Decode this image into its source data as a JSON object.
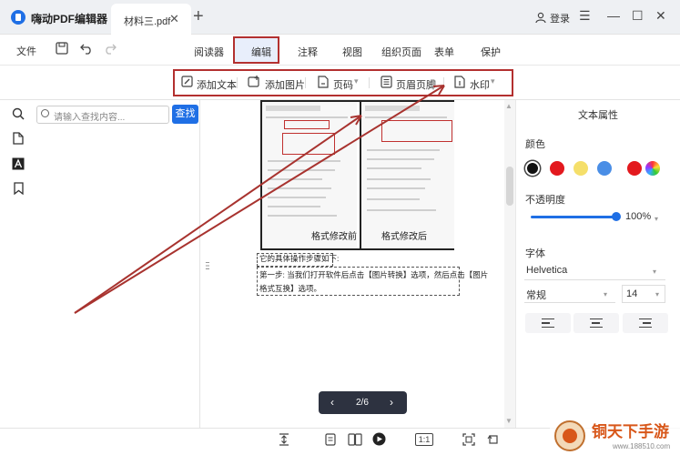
{
  "window": {
    "app_name": "嗨动PDF编辑器",
    "doc_tab": "材料三.pdf",
    "doc_tab_close": "✕",
    "add_tab": "+",
    "login": "登录",
    "controls": [
      "☰",
      "—",
      "☐",
      "✕"
    ]
  },
  "toolbar": {
    "file_menu": "文件",
    "tabs": [
      "阅读器",
      "编辑",
      "注释",
      "视图",
      "组织页面",
      "表单",
      "保护"
    ],
    "active_tab": "编辑"
  },
  "edit_tools": {
    "add_text": "添加文本",
    "add_image": "添加图片",
    "page_number": "页码",
    "header_footer": "页眉页脚",
    "watermark": "水印"
  },
  "sidebar": {
    "search_placeholder": "请输入查找内容...",
    "search_button": "查找",
    "icons": [
      "search-icon",
      "page-icon",
      "text-icon",
      "bookmark-icon"
    ]
  },
  "document": {
    "caption_before": "格式修改前",
    "caption_after": "格式修改后",
    "step_intro": "它的具体操作步骤如下:",
    "step_line1": "第一步: 当我们打开软件后点击【图片转换】选项，然后点击【图片",
    "step_line2": "格式互换】选项。"
  },
  "pager": {
    "label": "2/6",
    "prev": "‹",
    "next": "›"
  },
  "properties": {
    "title": "文本属性",
    "color_label": "颜色",
    "colors": [
      "#111111",
      "#e3191e",
      "#f5df6a",
      "#4a8ee6",
      "#e3191e"
    ],
    "opacity_label": "不透明度",
    "opacity_value": "100%",
    "font_label": "字体",
    "font_family": "Helvetica",
    "font_style": "常规",
    "font_size": "14"
  },
  "watermark_site": {
    "name": "铜天下手游",
    "url": "www.188510.com"
  },
  "colors": {
    "accent": "#1f6fe5",
    "highlight_box": "#b3302f",
    "arrow": "#a8332f"
  }
}
